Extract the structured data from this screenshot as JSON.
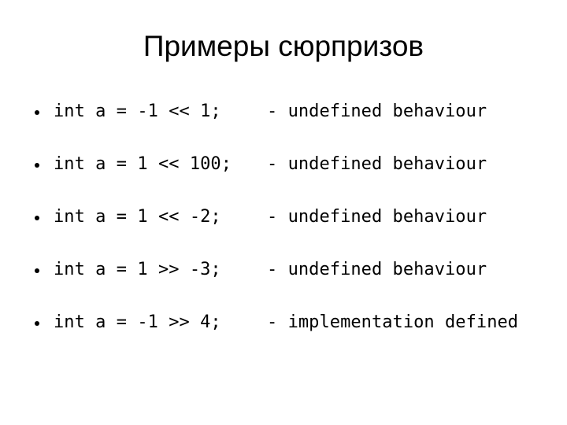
{
  "slide": {
    "title": "Примеры сюрпризов",
    "background_color": "#ffffff",
    "text_color": "#000000",
    "bullets": [
      {
        "bullet_glyph": "•",
        "code": "int a = -1 << 1;",
        "note": "- undefined behaviour",
        "full_text": "int a = -1 << 1;    - undefined behaviour"
      },
      {
        "bullet_glyph": "•",
        "code": "int a = 1 << 100;",
        "note": "- undefined behaviour",
        "full_text": "int a = 1 << 100;   - undefined behaviour"
      },
      {
        "bullet_glyph": "•",
        "code": "int a = 1 << -2;",
        "note": "- undefined behaviour",
        "full_text": "int a = 1 << -2;    - undefined behaviour"
      },
      {
        "bullet_glyph": "•",
        "code": "int a = 1 >> -3;",
        "note": "- undefined behaviour",
        "full_text": "int a = 1 >> -3;    - undefined behaviour"
      },
      {
        "bullet_glyph": "•",
        "code": "int a = -1 >> 4;",
        "note": "- implementation defined",
        "full_text": "int a = -1 >> 4;    - implementation defined"
      }
    ]
  }
}
